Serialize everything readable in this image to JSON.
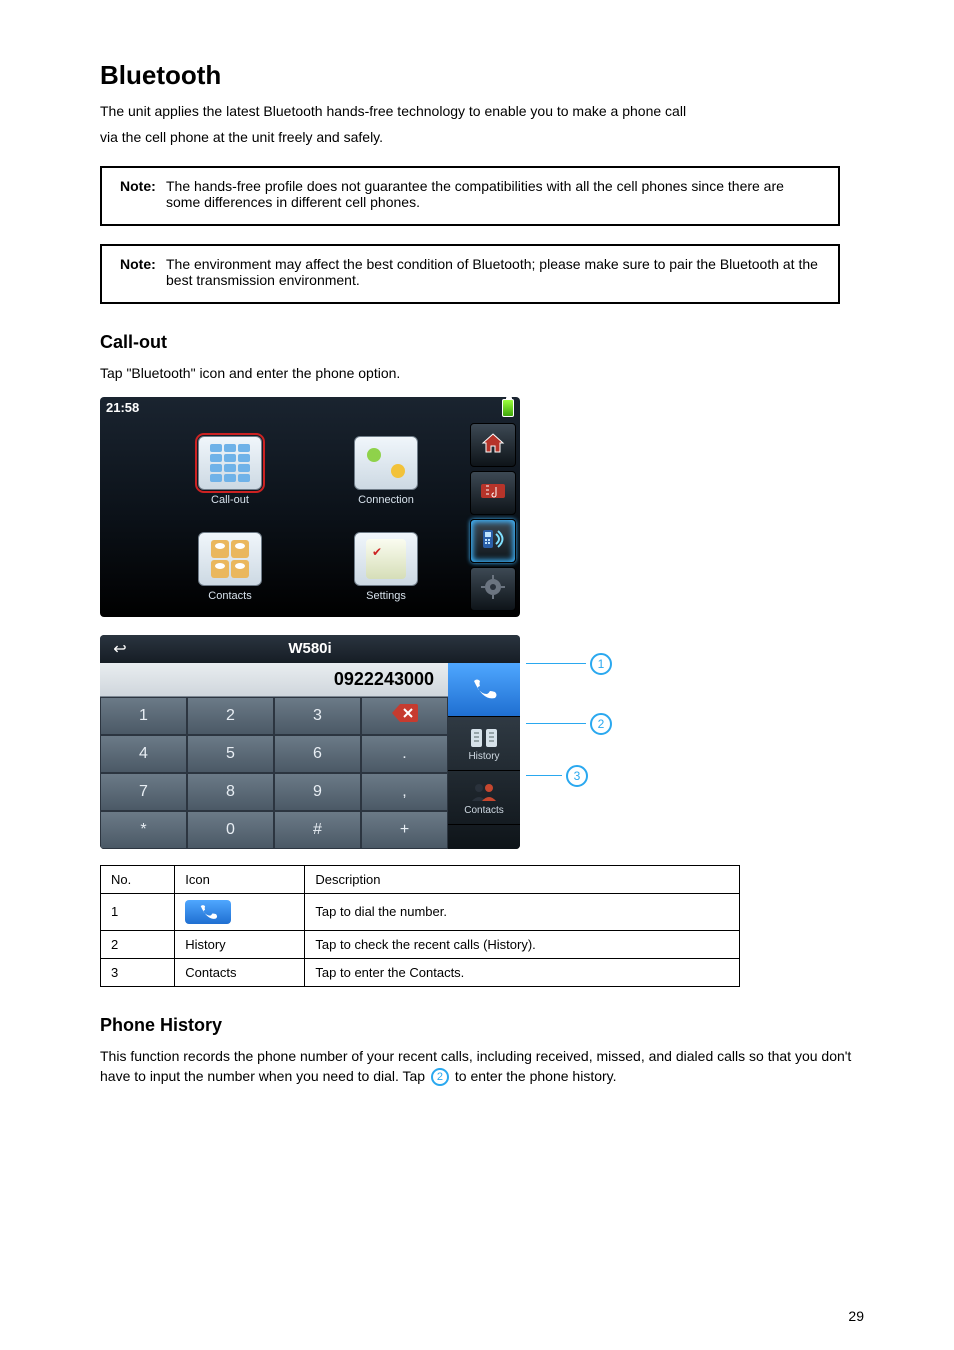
{
  "page": {
    "number": "29"
  },
  "heading": "Bluetooth",
  "intro_lines": [
    "The unit applies the latest Bluetooth hands-free technology to enable you to make a phone call",
    "via the cell phone at the unit freely and safely."
  ],
  "notes": [
    {
      "label": "Note:",
      "text": "The hands-free profile does not guarantee the compatibilities with all the cell phones since there are some differences in different cell phones."
    },
    {
      "label": "Note:",
      "text": "The environment may affect the best condition of Bluetooth; please make sure to pair the Bluetooth at the best transmission environment."
    }
  ],
  "section_callout": {
    "heading": "Call-out",
    "sub": "Tap \"Bluetooth\" icon and enter the phone option."
  },
  "menu_screen": {
    "clock": "21:58",
    "tiles": [
      {
        "label": "Call-out",
        "selected": true,
        "name": "tile-call-out"
      },
      {
        "label": "Connection",
        "selected": false,
        "name": "tile-connection"
      },
      {
        "label": "Contacts",
        "selected": false,
        "name": "tile-contacts"
      },
      {
        "label": "Settings",
        "selected": false,
        "name": "tile-settings"
      }
    ],
    "side": [
      {
        "name": "home-icon",
        "active": false
      },
      {
        "name": "media-icon",
        "active": false
      },
      {
        "name": "bluetooth-phone-icon",
        "active": true
      },
      {
        "name": "settings-gear-icon",
        "active": false
      }
    ]
  },
  "dialer_screen": {
    "title": "W580i",
    "number": "0922243000",
    "keys": [
      "1",
      "2",
      "3",
      "BSP",
      "4",
      "5",
      "6",
      ".",
      "7",
      "8",
      "9",
      ",",
      "*",
      "0",
      "#",
      "+"
    ],
    "right": [
      {
        "name": "call-button",
        "label": ""
      },
      {
        "name": "history-button",
        "label": "History"
      },
      {
        "name": "contacts-button",
        "label": "Contacts"
      }
    ],
    "callouts": [
      "1",
      "2",
      "3"
    ]
  },
  "legend": {
    "headers": [
      "No.",
      "Icon",
      "Description"
    ],
    "rows": [
      {
        "no": "1",
        "icon": "call",
        "desc": "Tap to dial the number."
      },
      {
        "no": "2",
        "icon": "history",
        "desc": "Tap to check the recent calls (History)."
      },
      {
        "no": "3",
        "icon": "contacts",
        "desc": "Tap to enter the Contacts."
      }
    ]
  },
  "history": {
    "heading": "Phone History",
    "para": [
      "This function records the phone number of your recent calls, including received, missed, and",
      "dialed calls so that you don't have to input the number when you need to dial. Tap ",
      " to enter",
      "the phone history."
    ],
    "bubble": "2"
  },
  "icons": {
    "call_label": "Call",
    "history_label": "History",
    "contacts_label": "Contacts"
  }
}
